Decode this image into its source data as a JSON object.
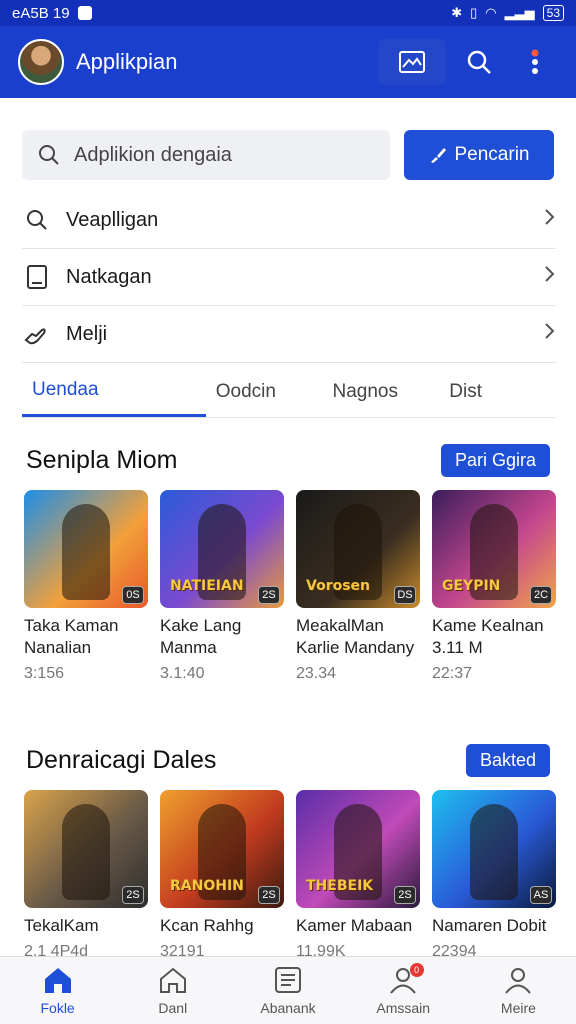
{
  "status_bar": {
    "left_text": "eA5B 19",
    "battery": "53"
  },
  "app_bar": {
    "title": "Applikpian"
  },
  "search": {
    "placeholder": "Adplikion dengaia",
    "button_label": "Pencarin"
  },
  "menu": [
    {
      "label": "Veaplligan",
      "icon": "search-icon"
    },
    {
      "label": "Natkagan",
      "icon": "tablet-icon"
    },
    {
      "label": "Melji",
      "icon": "hand-icon"
    }
  ],
  "tabs": [
    "Uendaa",
    "Oodcin",
    "Nagnos",
    "Dist"
  ],
  "section1": {
    "title": "Senipla Miom",
    "button": "Pari Ggira",
    "cards": [
      {
        "title_line1": "Taka Kaman",
        "title_line2": "Nanalian",
        "meta": "3:156",
        "badge": "0S",
        "logo": "",
        "bg": "linear-gradient(135deg,#1d8ee8,#f2a03a 60%,#e8572a)"
      },
      {
        "title_line1": "Kake Lang",
        "title_line2": "Manma",
        "meta": "3.1:40",
        "badge": "2S",
        "logo": "NATIEIAN",
        "bg": "linear-gradient(135deg,#2a5bd8,#7b4ad0 55%,#e89a3a)"
      },
      {
        "title_line1": "MeakalMan",
        "title_line2": "Karlie Mandany",
        "meta": "23.34",
        "badge": "DS",
        "logo": "Vorosen",
        "bg": "linear-gradient(135deg,#1a1a1a,#3a2e20 60%,#c98a2a)"
      },
      {
        "title_line1": "Kame Kealnan",
        "title_line2": "3.11 M",
        "meta": "22:37",
        "badge": "2C",
        "logo": "GEYPIN",
        "bg": "linear-gradient(135deg,#3a1e5a,#c4468e 55%,#f1a64a)"
      }
    ]
  },
  "section2": {
    "title": "Denraicagi Dales",
    "button": "Bakted",
    "cards": [
      {
        "title_line1": "TekalKam",
        "meta": "2.1 4P4d",
        "badge": "2S",
        "logo": "",
        "bg": "linear-gradient(135deg,#d9a34a,#6a5a48 55%,#2d2d2d)"
      },
      {
        "title_line1": "Kcan Rahhg",
        "meta": "32191",
        "badge": "2S",
        "logo": "RANOHIN",
        "bg": "linear-gradient(135deg,#f0a030,#c23c1e 55%,#3a1a10)"
      },
      {
        "title_line1": "Kamer Mabaan",
        "meta": "11.99K",
        "badge": "2S",
        "logo": "THEBEIK",
        "bg": "linear-gradient(135deg,#5a2ea8,#c04ab8 55%,#2a1a3a)"
      },
      {
        "title_line1": "Namaren Dobit",
        "meta": "22394",
        "badge": "AS",
        "logo": "",
        "bg": "linear-gradient(135deg,#1ec0f0,#2a5ad8 55%,#0a1a3a)"
      }
    ]
  },
  "bottom_nav": [
    {
      "label": "Fokle",
      "icon": "home-icon"
    },
    {
      "label": "Danl",
      "icon": "house-outline-icon"
    },
    {
      "label": "Abanank",
      "icon": "list-icon"
    },
    {
      "label": "Amssain",
      "icon": "user-notify-icon",
      "badge": "0"
    },
    {
      "label": "Meire",
      "icon": "person-icon"
    }
  ],
  "colors": {
    "primary": "#1f4fd6",
    "appbar": "#1a3fcc",
    "status": "#1230b8"
  }
}
